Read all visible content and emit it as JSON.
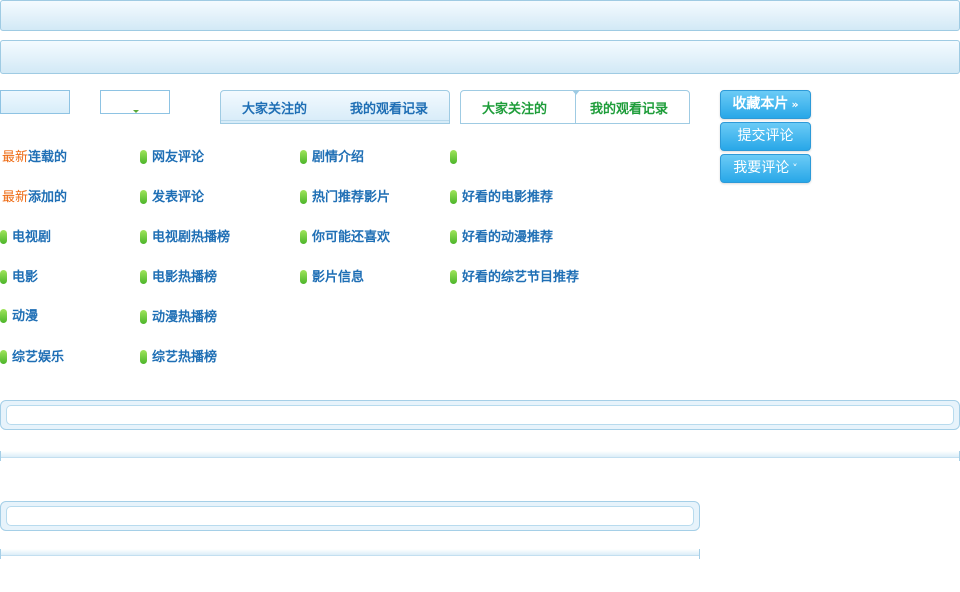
{
  "tabs_a": {
    "t1": "大家关注的",
    "t2": "我的观看记录"
  },
  "tabs_b": {
    "t1": "大家关注的",
    "t2": "我的观看记录"
  },
  "buttons": {
    "favorite": "收藏本片",
    "favorite_glyph": "»",
    "submit_comment": "提交评论",
    "my_comment": "我要评论",
    "my_comment_glyph": "˅"
  },
  "links": {
    "col1": [
      {
        "prefix": "最新",
        "label": "连载的"
      },
      {
        "prefix": "最新",
        "label": "添加的"
      },
      {
        "label": "电视剧"
      },
      {
        "label": "电影"
      },
      {
        "label": "动漫"
      },
      {
        "label": "综艺娱乐"
      }
    ],
    "col2": [
      "网友评论",
      "发表评论",
      "电视剧热播榜",
      "电影热播榜",
      "动漫热播榜",
      "综艺热播榜"
    ],
    "col3": [
      "剧情介绍",
      "热门推荐影片",
      "你可能还喜欢",
      "影片信息"
    ],
    "col4": [
      "",
      "好看的电影推荐",
      "好看的动漫推荐",
      "好看的综艺节目推荐"
    ]
  },
  "colors": {
    "link_blue": "#1f6fb5",
    "accent_orange": "#ee6a12",
    "tab_green": "#1e9d3a",
    "button_blue": "#28a7e8",
    "dot_green": "#4cb52a",
    "border_blue": "#9fcbe3"
  },
  "icons": {
    "bullet": "green-pill-bullet-icon",
    "dropdown": "dropdown-arrow-icon"
  }
}
